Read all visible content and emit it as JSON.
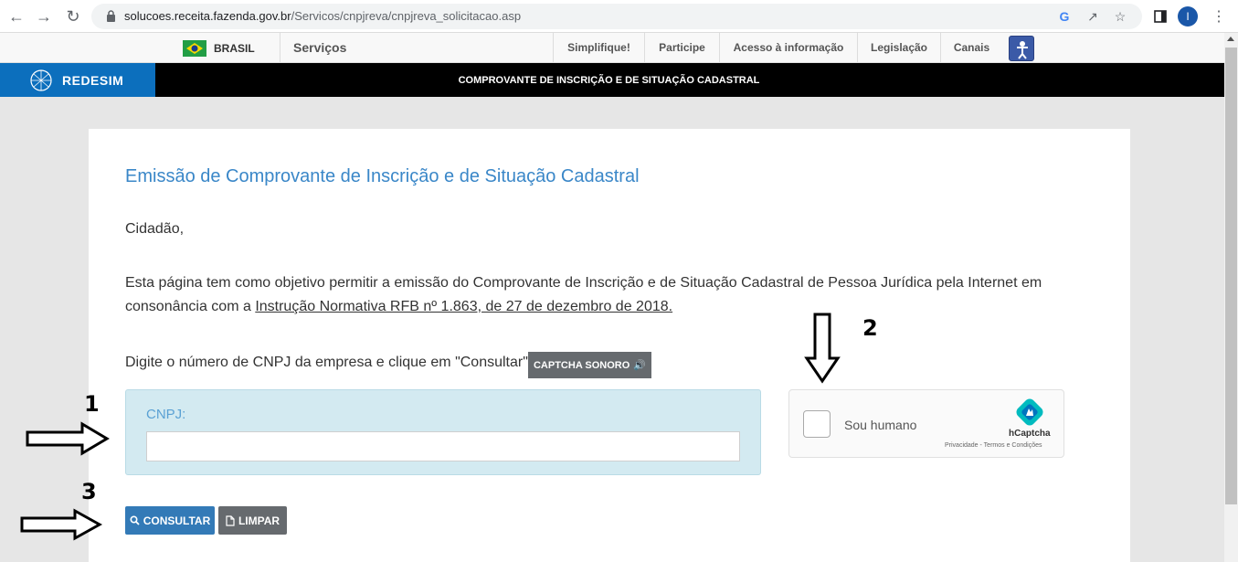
{
  "browser": {
    "url_host": "solucoes.receita.fazenda.gov.br",
    "url_path": "/Servicos/cnpjreva/cnpjreva_solicitacao.asp",
    "profile_initial": "I"
  },
  "gov_bar": {
    "country": "BRASIL",
    "services": "Serviços",
    "links": [
      "Simplifique!",
      "Participe",
      "Acesso à informação",
      "Legislação",
      "Canais"
    ]
  },
  "redesim": {
    "logo_text": "REDESIM",
    "header_title": "COMPROVANTE DE INSCRIÇÃO E DE SITUAÇÃO CADASTRAL"
  },
  "main": {
    "title": "Emissão de Comprovante de Inscrição e de Situação Cadastral",
    "greeting": "Cidadão,",
    "intro_text": "Esta página tem como objetivo permitir a emissão do Comprovante de Inscrição e de Situação Cadastral de Pessoa Jurídica pela Internet em consonância com a ",
    "intro_link": "Instrução Normativa RFB nº 1.863, de 27 de dezembro de 2018.",
    "instruction": "Digite o número de CNPJ da empresa e clique em \"Consultar\".",
    "captcha_audio_label": "CAPTCHA SONORO",
    "cnpj_label": "CNPJ:",
    "cnpj_value": "",
    "consultar_label": "CONSULTAR",
    "limpar_label": "LIMPAR"
  },
  "hcaptcha": {
    "label": "Sou humano",
    "brand": "hCaptcha",
    "links": "Privacidade - Termos e Condições"
  },
  "annotations": {
    "step1": "1",
    "step2": "2",
    "step3": "3"
  },
  "colors": {
    "accent_blue": "#3a87c8",
    "redesim_blue": "#0c6fbd",
    "button_primary": "#337ab7",
    "button_secondary": "#666a6e",
    "cnpj_box_bg": "#d3eaf1"
  }
}
